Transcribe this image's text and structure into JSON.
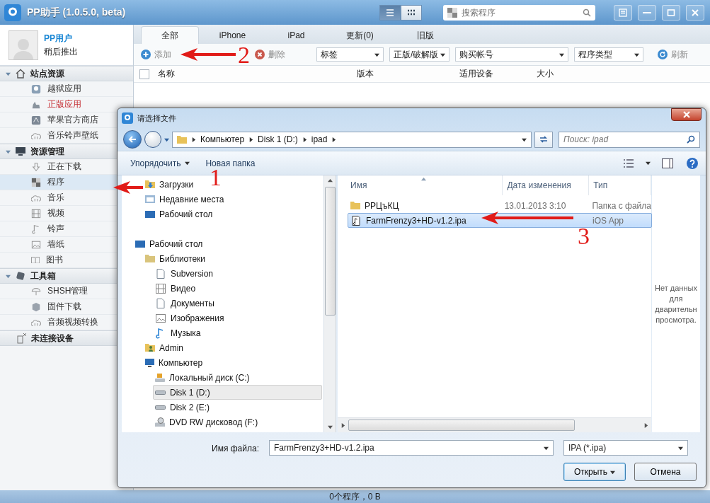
{
  "window": {
    "title": "PP助手 (1.0.5.0, beta)",
    "view_modes": [
      {
        "kind": "list",
        "selected": true
      },
      {
        "kind": "grid",
        "selected": false
      }
    ],
    "search": {
      "placeholder": "搜索程序"
    }
  },
  "user": {
    "name": "PP用户",
    "subtitle": "稍后推出"
  },
  "sidebar": {
    "sections": [
      {
        "label": "站点资源",
        "kind": "home",
        "expanded": true,
        "items": [
          {
            "label": "越狱应用",
            "kind": "logo",
            "selected": false,
            "featured": false
          },
          {
            "label": "正版应用",
            "kind": "bag",
            "selected": false,
            "featured": true
          },
          {
            "label": "苹果官方商店",
            "kind": "store",
            "selected": false,
            "featured": false
          },
          {
            "label": "音乐铃声壁纸",
            "kind": "cloud",
            "selected": false,
            "featured": false
          }
        ]
      },
      {
        "label": "资源管理",
        "kind": "monitor",
        "expanded": true,
        "items": [
          {
            "label": "正在下载",
            "kind": "download",
            "selected": false,
            "featured": false
          },
          {
            "label": "程序",
            "kind": "grid",
            "selected": true,
            "featured": false
          },
          {
            "label": "音乐",
            "kind": "cloud",
            "selected": false,
            "featured": false
          },
          {
            "label": "视频",
            "kind": "film",
            "selected": false,
            "featured": false
          },
          {
            "label": "铃声",
            "kind": "note",
            "selected": false,
            "featured": false
          },
          {
            "label": "墙纸",
            "kind": "picture",
            "selected": false,
            "featured": false
          },
          {
            "label": "图书",
            "kind": "book",
            "selected": false,
            "featured": false
          }
        ]
      },
      {
        "label": "工具箱",
        "kind": "toolbox",
        "expanded": true,
        "items": [
          {
            "label": "SHSH管理",
            "kind": "umbrella",
            "selected": false,
            "featured": false
          },
          {
            "label": "固件下载",
            "kind": "cube",
            "selected": false,
            "featured": false
          },
          {
            "label": "音频视频转换",
            "kind": "cloud",
            "selected": false,
            "featured": false
          }
        ]
      },
      {
        "label": "未连接设备",
        "kind": "device"
      }
    ]
  },
  "tabs": [
    {
      "label": "全部",
      "selected": true
    },
    {
      "label": "iPhone",
      "selected": false
    },
    {
      "label": "iPad",
      "selected": false
    },
    {
      "label": "更新(0)",
      "selected": false
    },
    {
      "label": "旧版",
      "selected": false
    }
  ],
  "toolbar": {
    "buttons": [
      {
        "label": "添加",
        "kind": "add"
      },
      {
        "label": "删除",
        "kind": "delete"
      }
    ],
    "filters": [
      "标签",
      "正版/破解版",
      "购买帐号",
      "程序类型"
    ],
    "refresh": "刷新"
  },
  "table": {
    "select_all": {
      "checked": false
    },
    "columns": [
      "名称",
      "版本",
      "适用设备",
      "大小"
    ]
  },
  "status_bar": "0个程序，0 B",
  "dialog": {
    "title": "请选择文件",
    "path": [
      "Компьютер",
      "Disk 1 (D:)",
      "ipad"
    ],
    "search": {
      "placeholder": "Поиск: ipad"
    },
    "commands": [
      {
        "label": "Упорядочить",
        "kind": "menu"
      },
      {
        "label": "Новая папка",
        "kind": "plain"
      }
    ],
    "favorites": [
      {
        "label": "Загрузки",
        "kind": "downloads",
        "selected": false
      },
      {
        "label": "Недавние места",
        "kind": "recent",
        "selected": false
      },
      {
        "label": "Рабочий стол",
        "kind": "desktop",
        "selected": false
      }
    ],
    "tree": [
      {
        "label": "Рабочий стол",
        "kind": "desktop",
        "selected": false,
        "children": [
          {
            "label": "Библиотеки",
            "kind": "library",
            "selected": false,
            "children": [
              {
                "label": "Subversion",
                "kind": "doc",
                "selected": false
              },
              {
                "label": "Видео",
                "kind": "film",
                "selected": false
              },
              {
                "label": "Документы",
                "kind": "doc",
                "selected": false
              },
              {
                "label": "Изображения",
                "kind": "picture",
                "selected": false
              },
              {
                "label": "Музыка",
                "kind": "music",
                "selected": false
              }
            ]
          },
          {
            "label": "Admin",
            "kind": "user",
            "selected": false
          },
          {
            "label": "Компьютер",
            "kind": "computer",
            "selected": false,
            "children": [
              {
                "label": "Локальный диск (C:)",
                "kind": "windisk",
                "selected": false
              },
              {
                "label": "Disk 1 (D:)",
                "kind": "drive",
                "selected": true
              },
              {
                "label": "Disk 2 (E:)",
                "kind": "drive",
                "selected": false
              },
              {
                "label": "DVD RW дисковод (F:)",
                "kind": "dvd",
                "selected": false
              }
            ]
          }
        ]
      }
    ],
    "columns": [
      "Имя",
      "Дата изменения",
      "Тип"
    ],
    "files": [
      {
        "name": "РРЦъКЦ",
        "kind": "folder",
        "date": "13.01.2013 3:10",
        "type": "Папка с файла",
        "selected": false
      },
      {
        "name": "FarmFrenzy3+HD-v1.2.ipa",
        "kind": "audio",
        "type": "iOS App",
        "selected": true
      }
    ],
    "preview": [
      "Нет данных",
      "для",
      "дварительн",
      "просмотра."
    ],
    "filename_label": "Имя файла:",
    "filename": "FarmFrenzy3+HD-v1.2.ipa",
    "filetype": "IPA (*.ipa)",
    "buttons": [
      {
        "label": "Открыть",
        "kind": "split"
      },
      {
        "label": "Отмена",
        "kind": "plain"
      }
    ]
  },
  "annotations": [
    "1",
    "2",
    "3"
  ]
}
